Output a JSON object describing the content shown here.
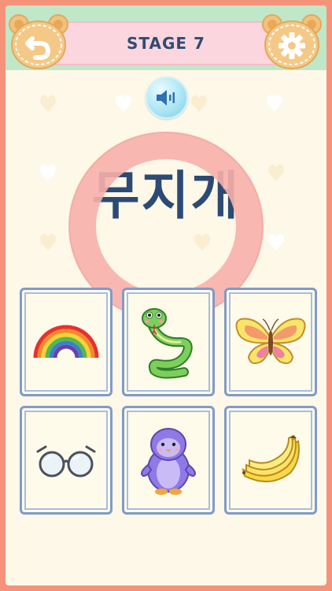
{
  "header": {
    "title": "STAGE 7",
    "back_icon": "back-arrow-icon",
    "settings_icon": "gear-icon"
  },
  "prompt": {
    "word": "무지개",
    "sound_icon": "speaker-icon"
  },
  "cards": [
    {
      "name": "rainbow",
      "icon": "rainbow-icon"
    },
    {
      "name": "snake",
      "icon": "snake-icon"
    },
    {
      "name": "butterfly",
      "icon": "butterfly-icon"
    },
    {
      "name": "glasses",
      "icon": "glasses-icon"
    },
    {
      "name": "penguin",
      "icon": "penguin-icon"
    },
    {
      "name": "banana",
      "icon": "banana-icon"
    }
  ],
  "colors": {
    "border": "#f4937a",
    "header_bg": "#bfe7c8",
    "title_bg": "#fbd6de",
    "title_text": "#2f4d73",
    "card_border": "#7f9bc9",
    "ring": "#f5a9a6"
  }
}
